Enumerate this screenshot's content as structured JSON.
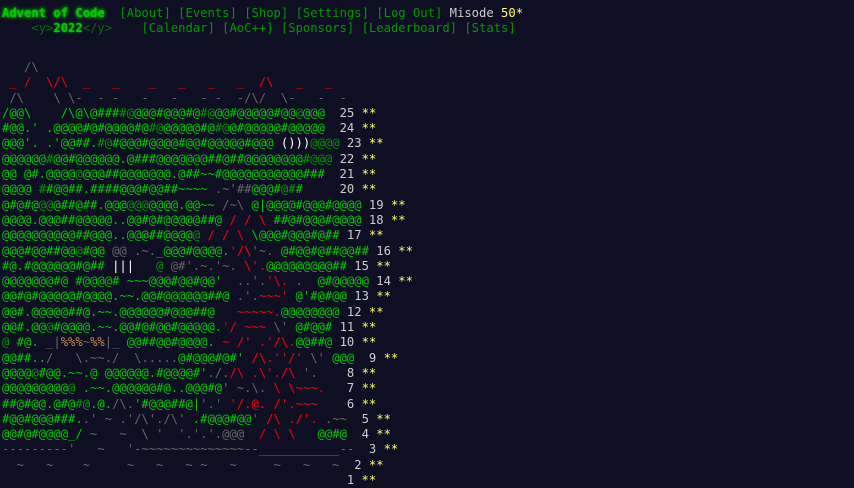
{
  "header": {
    "title": "Advent of Code",
    "tagline_open": "<y>",
    "year": "2022",
    "tagline_close": "</y>",
    "nav_top": [
      "[About]",
      "[Events]",
      "[Shop]",
      "[Settings]",
      "[Log Out]"
    ],
    "user": "Misode",
    "star_count": "50*",
    "nav_bottom": [
      "[Calendar]",
      "[AoC++]",
      "[Sponsors]",
      "[Leaderboard]",
      "[Stats]"
    ]
  },
  "colors": {
    "background": "#0f0f23",
    "title_green": "#00cc00",
    "link_green": "#009900",
    "star_yellow": "#ffff66",
    "text_gray": "#cccccc",
    "red": "#ff0000"
  },
  "calendar": {
    "top_art": [
      "   /\\",
      " _ /  \\/\\  _   _    _   _   _   _  /\\   _   _",
      " /\\    \\ \\-  - -   -   -   - -  -/\\/  \\-   -  -"
    ],
    "days": [
      {
        "day": "25",
        "stars": "**",
        "segs": [
          [
            "/@@\\    /\\@\\@###",
            "g"
          ],
          [
            "#@",
            "dg"
          ],
          [
            "@@@#@@@#@",
            "g"
          ],
          [
            "#@",
            "dg"
          ],
          [
            "@@#@",
            "g"
          ],
          [
            "@@@@#@@",
            "g"
          ],
          [
            "@",
            "dg"
          ],
          [
            "@@@",
            "g"
          ]
        ]
      },
      {
        "day": "24",
        "stars": "**",
        "segs": [
          [
            "#@@.'",
            "g"
          ],
          [
            " .@@@@#@#@@@@#@",
            "g"
          ],
          [
            "#@",
            "dg"
          ],
          [
            "@@@@@#@",
            "g"
          ],
          [
            "#@",
            "dg"
          ],
          [
            "@#@@@@@#@@@@@",
            "g"
          ]
        ]
      },
      {
        "day": "23",
        "stars": "**",
        "segs": [
          [
            "@@@'. .'@@##.",
            "g"
          ],
          [
            "#@",
            "dg"
          ],
          [
            "#@@@#@@@@",
            "g"
          ],
          [
            "#@@#@@@@@#@@@",
            "g"
          ],
          [
            " ()))",
            "w"
          ],
          [
            "@@@@",
            "dg"
          ]
        ]
      },
      {
        "day": "22",
        "stars": "**",
        "segs": [
          [
            "@@@@@@",
            "g"
          ],
          [
            "#",
            "dg"
          ],
          [
            "@@",
            "g"
          ],
          [
            "#@@@@@@.@###@@@@@@@##@##@@@@@@@@",
            "g"
          ],
          [
            "#@@@",
            "dg"
          ]
        ]
      },
      {
        "day": "21",
        "stars": "**",
        "segs": [
          [
            "@@ @#.@@@@",
            "g"
          ],
          [
            "@",
            "dg"
          ],
          [
            "@@@##@@@@@@@.@##~~#@@@@@@@@@@@###",
            "g"
          ]
        ]
      },
      {
        "day": "20",
        "stars": "**",
        "segs": [
          [
            "@@@@",
            "g"
          ],
          [
            " #",
            "dg"
          ],
          [
            "#@@##.####@@@#@@##~~~~",
            "g"
          ],
          [
            " .~'##",
            "gray"
          ],
          [
            "@@@#",
            "g"
          ],
          [
            "@#",
            "dg"
          ],
          [
            "#",
            "g"
          ]
        ]
      },
      {
        "day": "19",
        "stars": "**",
        "segs": [
          [
            "@#@#@",
            "g"
          ],
          [
            "@@",
            "dg"
          ],
          [
            "@##@##.@@@",
            "g"
          ],
          [
            "@@@",
            "dg"
          ],
          [
            "@@@@.@@~~",
            "g"
          ],
          [
            " /~\\",
            "gray"
          ],
          [
            " @|@@@@#@@@#@@@@",
            "g"
          ]
        ]
      },
      {
        "day": "18",
        "stars": "**",
        "segs": [
          [
            "@@@@.@@@##@@@@@..@@#@#@@@@@##@",
            "g"
          ],
          [
            " / ",
            "r"
          ],
          [
            "/ \\",
            "r"
          ],
          [
            " ##@#@@@#@@@@",
            "g"
          ]
        ]
      },
      {
        "day": "17",
        "stars": "**",
        "segs": [
          [
            "@@@@@@@@@@##@@@..@@@##@@@@",
            "g"
          ],
          [
            "@",
            "dg"
          ],
          [
            " / ",
            "r"
          ],
          [
            "/ \\",
            "r"
          ],
          [
            " \\@@@#@@@#@##",
            "g"
          ]
        ]
      },
      {
        "day": "16",
        "stars": "**",
        "segs": [
          [
            "@@@#@@##@@",
            "g"
          ],
          [
            "@",
            "dg"
          ],
          [
            "#@@",
            "g"
          ],
          [
            " @@ .~.",
            "gray"
          ],
          [
            "_@@@#@@@@.",
            "g"
          ],
          [
            "'/\\",
            "r"
          ],
          [
            "'~.",
            "gray"
          ],
          [
            " @#@@#@##@@##",
            "g"
          ]
        ]
      },
      {
        "day": "15",
        "stars": "**",
        "segs": [
          [
            "#@.",
            "g"
          ],
          [
            "#@@@@@@#@##",
            "g"
          ],
          [
            " |||",
            "w"
          ],
          [
            "   ",
            "gray"
          ],
          [
            "@",
            "dg"
          ],
          [
            " @#'.~.",
            "gray"
          ],
          [
            "'~.",
            "gray"
          ],
          [
            " \\'.",
            "r"
          ],
          [
            "@@@@@@@@@##",
            "g"
          ]
        ]
      },
      {
        "day": "14",
        "stars": "**",
        "segs": [
          [
            "@@@@@@@#@",
            "g"
          ],
          [
            " #@@@@#",
            "g"
          ],
          [
            " ~~~@@@#@@#@@'",
            "g"
          ],
          [
            "  ..'.",
            "gray"
          ],
          [
            "'\\.",
            "r"
          ],
          [
            " .",
            "gray"
          ],
          [
            "  @#@@@@@",
            "g"
          ]
        ]
      },
      {
        "day": "13",
        "stars": "**",
        "segs": [
          [
            "@@#@#@@@@@#@@@@.~~.@@#@@@@@@##@",
            "g"
          ],
          [
            " .'.",
            "gray"
          ],
          [
            "~~~'",
            "r"
          ],
          [
            " @'#@#@@",
            "g"
          ]
        ]
      },
      {
        "day": "12",
        "stars": "**",
        "segs": [
          [
            "@@#.@@@@@##@.~~.@@@@@@#",
            "g"
          ],
          [
            "@@@##@",
            "g"
          ],
          [
            "   ~~~~~.",
            "r"
          ],
          [
            "@@@@@@@@",
            "g"
          ]
        ]
      },
      {
        "day": "11",
        "stars": "**",
        "segs": [
          [
            "@@#.@@",
            "g"
          ],
          [
            "@",
            "dg"
          ],
          [
            "#@@@@.~~.@@#@#@",
            "g"
          ],
          [
            "@#@@@@@.",
            "g"
          ],
          [
            "'/",
            "r"
          ],
          [
            " ~~~",
            "r"
          ],
          [
            " \\'",
            "gray"
          ],
          [
            " @#@@#",
            "g"
          ]
        ]
      },
      {
        "day": "10",
        "stars": "**",
        "segs": [
          [
            "@",
            "dg"
          ],
          [
            " #@.",
            "g"
          ],
          [
            " _|",
            "gray"
          ],
          [
            "%%%",
            "o"
          ],
          [
            "~",
            "gray"
          ],
          [
            "%%",
            "o"
          ],
          [
            "|_",
            "gray"
          ],
          [
            " @@##@@#@@@@.",
            "g"
          ],
          [
            " ~ /'",
            "r"
          ],
          [
            " .'/\\.",
            "r"
          ],
          [
            "@@##@",
            "g"
          ]
        ]
      },
      {
        "day": "9",
        "stars": "**",
        "segs": [
          [
            "@@##..",
            "g"
          ],
          [
            "/   \\.~~./  \\.....",
            "gray"
          ],
          [
            "@#@@@#@#'",
            "g"
          ],
          [
            " /\\.''/'",
            "r"
          ],
          [
            " \\'",
            "gray"
          ],
          [
            " @@@",
            "g"
          ]
        ]
      },
      {
        "day": "8",
        "stars": "**",
        "segs": [
          [
            "@@@@",
            "g"
          ],
          [
            "@",
            "dg"
          ],
          [
            "#@@.~~.@ @@@@@@.#@@@@#'",
            "g"
          ],
          [
            "./.",
            "gray"
          ],
          [
            "/\\",
            "r"
          ],
          [
            " .\\'./\\",
            "r"
          ],
          [
            " '.",
            "gray"
          ]
        ]
      },
      {
        "day": "7",
        "stars": "**",
        "segs": [
          [
            "@@@@@@@@@",
            "g"
          ],
          [
            "@",
            "dg"
          ],
          [
            " .~~.@@@@@@#@..@@@#@'",
            "g"
          ],
          [
            " ~.\\.",
            "gray"
          ],
          [
            " \\ \\",
            "r"
          ],
          [
            "~~~.",
            "r"
          ]
        ]
      },
      {
        "day": "6",
        "stars": "**",
        "segs": [
          [
            "##@#@@.@#@",
            "g"
          ],
          [
            "#@",
            "dg"
          ],
          [
            ".@.",
            "g"
          ],
          [
            "/\\.",
            "gray"
          ],
          [
            "'#@@@##@|",
            "g"
          ],
          [
            "'.'",
            "gray"
          ],
          [
            " '/.@.",
            "r"
          ],
          [
            " /'.~~~",
            "r"
          ]
        ]
      },
      {
        "day": "5",
        "stars": "**",
        "segs": [
          [
            "#@@#@@@###.",
            "g"
          ],
          [
            ".' ~",
            "gray"
          ],
          [
            " .'/\\'./\\'",
            "gray"
          ],
          [
            " .#@@@#@@",
            "g"
          ],
          [
            "'",
            "gray"
          ],
          [
            " /\\",
            "r"
          ],
          [
            " ./'.",
            "r"
          ],
          [
            " .~~",
            "gray"
          ]
        ]
      },
      {
        "day": "4",
        "stars": "**",
        "segs": [
          [
            "@@#@#@@@@_/",
            "g"
          ],
          [
            " ~",
            "gray"
          ],
          [
            "   ~ ",
            "gray"
          ],
          [
            " \\ '  '.'.'.@@@",
            "gray"
          ],
          [
            "  / \\ ",
            "r"
          ],
          [
            "\\",
            "r"
          ],
          [
            "   @@#@",
            "g"
          ]
        ]
      },
      {
        "day": "3",
        "stars": "**",
        "segs": [
          [
            "---------'",
            "gray"
          ],
          [
            "   ~",
            "gray"
          ],
          [
            "   '-~~~~~~~~~~~~~~--___________--",
            "gray"
          ]
        ]
      },
      {
        "day": "2",
        "stars": "**",
        "segs": [
          [
            "  ~   ~    ~     ~   ~   ~ ~   ~     ~   ~   ~",
            "gray"
          ]
        ]
      },
      {
        "day": "1",
        "stars": "**",
        "segs": [
          [
            "",
            "gray"
          ]
        ]
      }
    ]
  }
}
